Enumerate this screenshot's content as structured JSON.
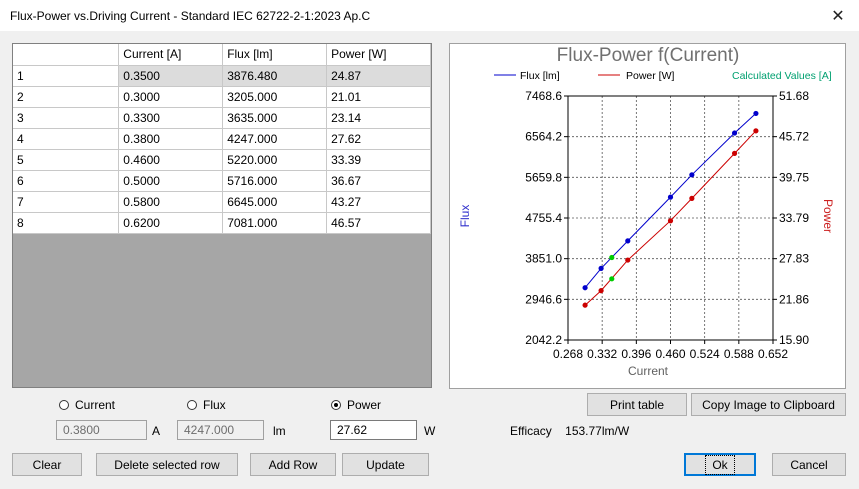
{
  "window": {
    "title": "Flux-Power vs.Driving Current  -  Standard IEC 62722-2-1:2023 Ap.C",
    "close_glyph": "✕"
  },
  "table": {
    "headers": [
      "",
      "Current [A]",
      "Flux [lm]",
      "Power  [W]"
    ],
    "rows": [
      {
        "n": "1",
        "current": "0.3500",
        "flux": "3876.480",
        "power": "24.87",
        "selected": true
      },
      {
        "n": "2",
        "current": "0.3000",
        "flux": "3205.000",
        "power": "21.01"
      },
      {
        "n": "3",
        "current": "0.3300",
        "flux": "3635.000",
        "power": "23.14"
      },
      {
        "n": "4",
        "current": "0.3800",
        "flux": "4247.000",
        "power": "27.62"
      },
      {
        "n": "5",
        "current": "0.4600",
        "flux": "5220.000",
        "power": "33.39"
      },
      {
        "n": "6",
        "current": "0.5000",
        "flux": "5716.000",
        "power": "36.67"
      },
      {
        "n": "7",
        "current": "0.5800",
        "flux": "6645.000",
        "power": "43.27"
      },
      {
        "n": "8",
        "current": "0.6200",
        "flux": "7081.000",
        "power": "46.57"
      }
    ]
  },
  "chart_data": {
    "type": "line",
    "title": "Flux-Power f(Current)",
    "xlabel": "Current",
    "ylabel_left": "Flux",
    "ylabel_right": "Power",
    "xlim": [
      0.268,
      0.652
    ],
    "ylim_left": [
      2042.2,
      7468.6
    ],
    "ylim_right": [
      15.9,
      51.68
    ],
    "x_ticks": [
      "0.268",
      "0.332",
      "0.396",
      "0.460",
      "0.524",
      "0.588",
      "0.652"
    ],
    "y_left_ticks": [
      "2042.2",
      "2946.6",
      "3851.0",
      "4755.4",
      "5659.8",
      "6564.2",
      "7468.6"
    ],
    "y_right_ticks": [
      "15.90",
      "21.86",
      "27.83",
      "33.79",
      "39.75",
      "45.72",
      "51.68"
    ],
    "grid": true,
    "legend": [
      "Flux [lm]",
      "Power  [W]",
      "Calculated Values [A]"
    ],
    "series": [
      {
        "name": "Flux [lm]",
        "axis": "left",
        "color": "#0000cc",
        "x": [
          0.3,
          0.33,
          0.38,
          0.46,
          0.5,
          0.58,
          0.62
        ],
        "y": [
          3205.0,
          3635.0,
          4247.0,
          5220.0,
          5716.0,
          6645.0,
          7081.0
        ]
      },
      {
        "name": "Power  [W]",
        "axis": "right",
        "color": "#cc0000",
        "x": [
          0.3,
          0.33,
          0.38,
          0.46,
          0.5,
          0.58,
          0.62
        ],
        "y": [
          21.01,
          23.14,
          27.62,
          33.39,
          36.67,
          43.27,
          46.57
        ]
      }
    ],
    "calculated": {
      "x": 0.35,
      "flux": 3876.48,
      "power": 24.87,
      "color": "#00cc00",
      "legend_color": "#00a070"
    }
  },
  "inputs": {
    "current": {
      "label": "Current",
      "value": "0.3800",
      "unit": "A",
      "checked": false
    },
    "flux": {
      "label": "Flux",
      "value": "4247.000",
      "unit": "lm",
      "checked": false
    },
    "power": {
      "label": "Power",
      "value": "27.62",
      "unit": "W",
      "checked": true
    }
  },
  "efficacy": {
    "label": "Efficacy",
    "value": "153.77lm/W"
  },
  "buttons": {
    "print_table": "Print table",
    "copy_image": "Copy Image to Clipboard",
    "clear": "Clear",
    "delete_row": "Delete selected row",
    "add_row": "Add Row",
    "update": "Update",
    "ok": "Ok",
    "cancel": "Cancel"
  }
}
